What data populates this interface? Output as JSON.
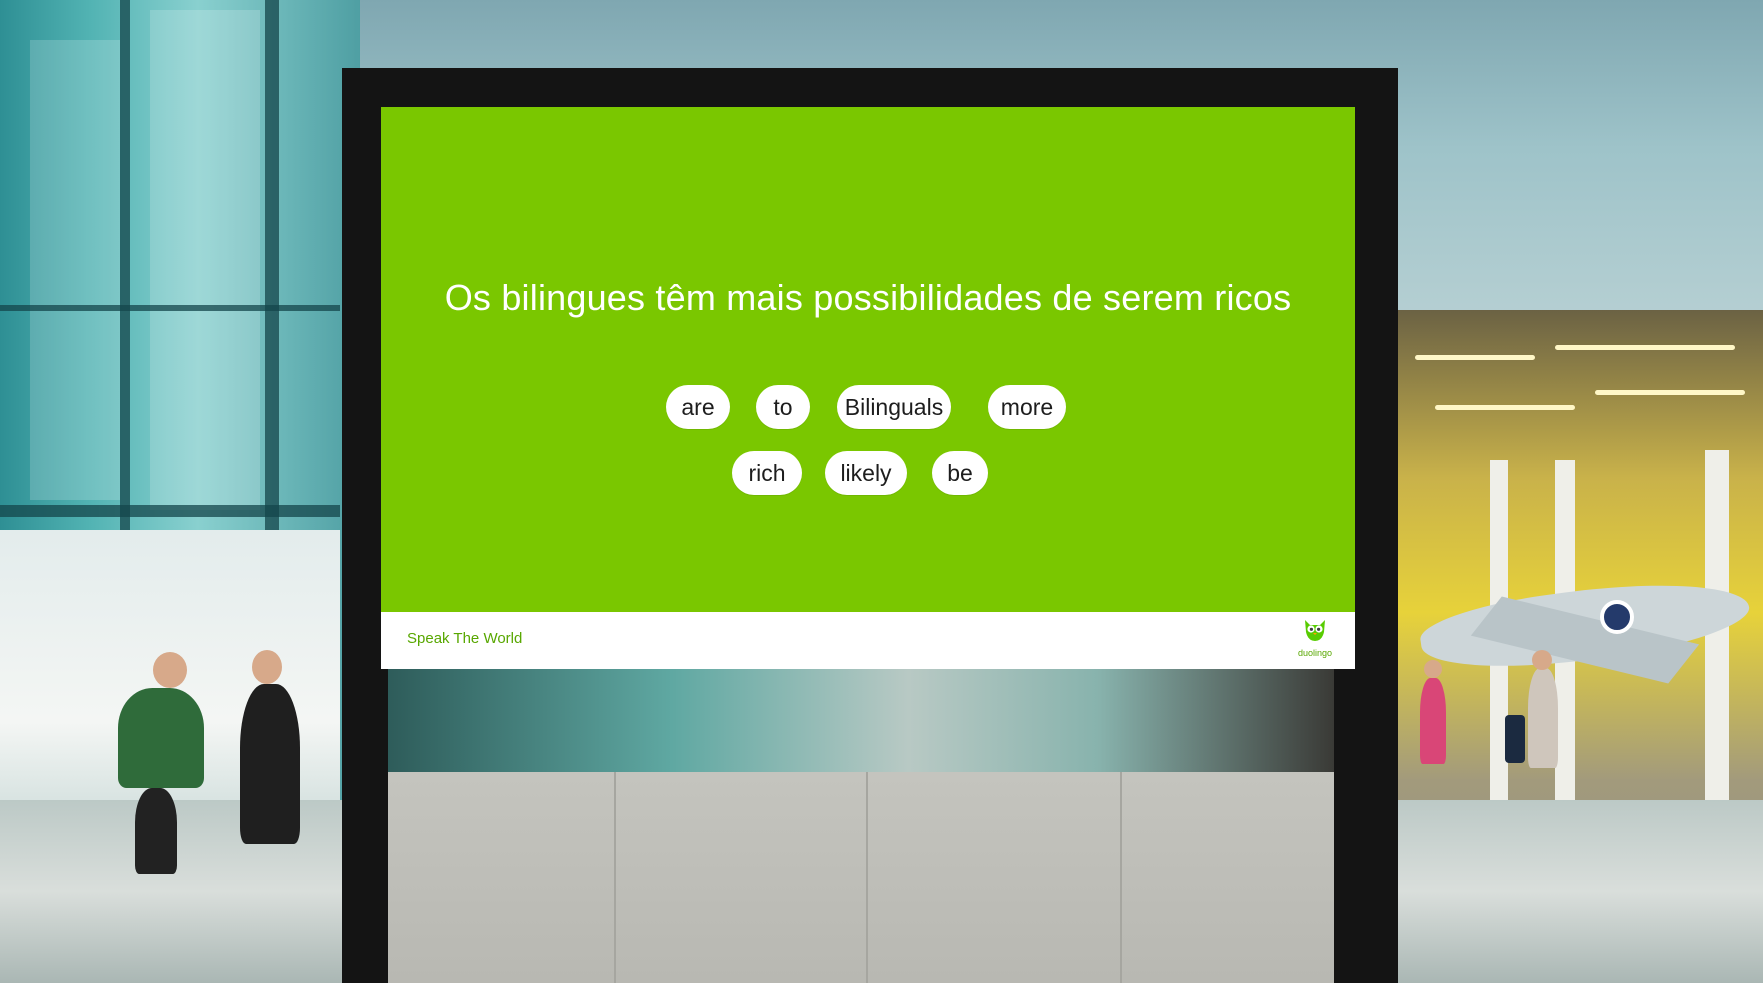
{
  "billboard": {
    "prompt": "Os bilingues têm mais possibilidades de serem ricos",
    "word_bank_row1": [
      "are",
      "to",
      "Bilinguals",
      "more"
    ],
    "word_bank_row2": [
      "rich",
      "likely",
      "be"
    ],
    "tagline": "Speak The World",
    "brand": "duolingo",
    "colors": {
      "screen": "#7ac700",
      "chip": "#ffffff",
      "chip_text": "#1d1d1d",
      "tagline": "#58a700"
    },
    "icons": {
      "logo": "owl-icon"
    }
  }
}
